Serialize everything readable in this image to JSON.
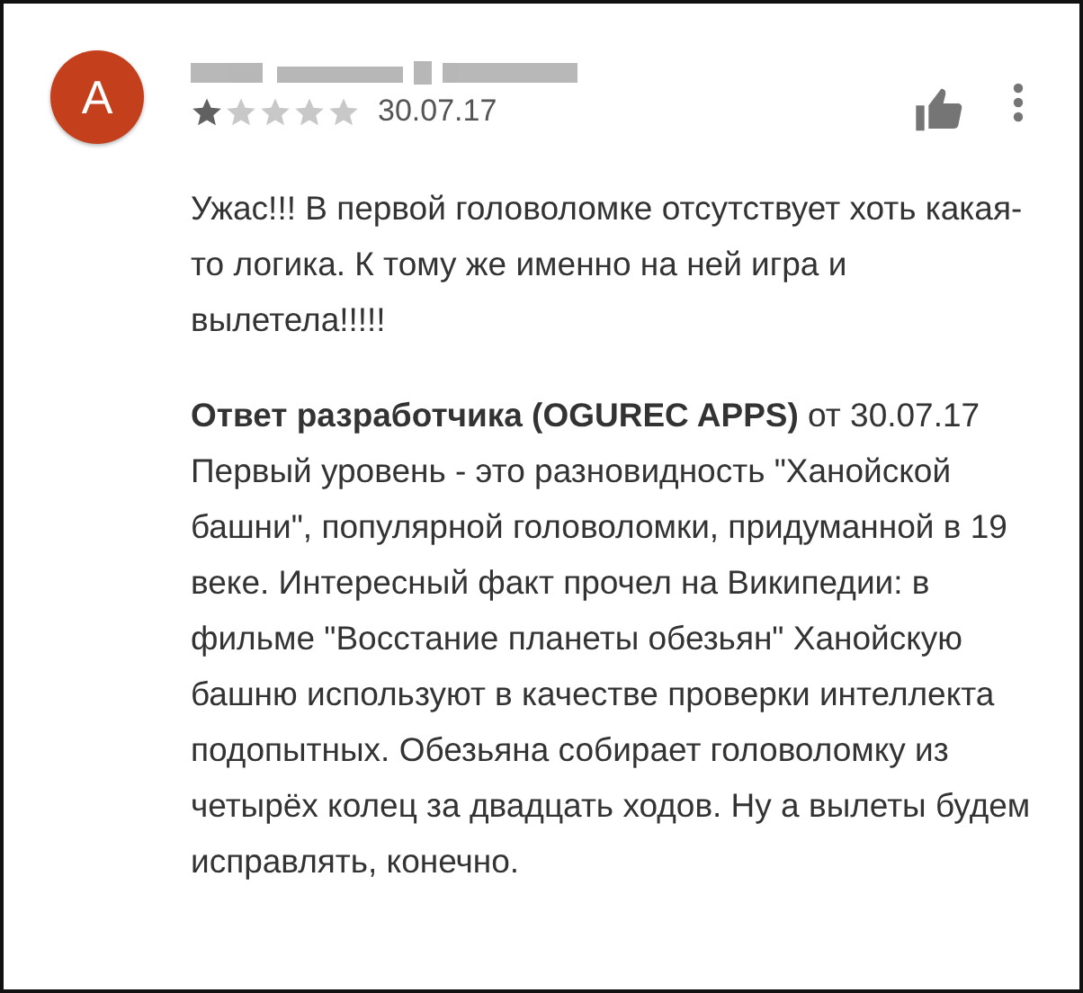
{
  "review": {
    "avatar_letter": "A",
    "stars": 1,
    "date": "30.07.17",
    "text": "Ужас!!! В первой головоломке отсутствует хоть какая-то логика. К тому же именно на ней игра и вылетела!!!!!"
  },
  "developer_reply": {
    "heading": "**Ответ разработчика (OGUREC APPS)** от 30.07.17",
    "text": "Первый уровень - это разновидность \"Ханойской башни\", популярной головоломки, придуманной в 19 веке. Интересный факт прочел на Википедии: в фильме \"Восстание планеты обезьян\" Ханойскую башню используют в качестве проверки интеллекта подопытных. Обезьяна собирает головоломку из четырёх колец за двадцать ходов. Ну а вылеты будем исправлять, конечно."
  }
}
